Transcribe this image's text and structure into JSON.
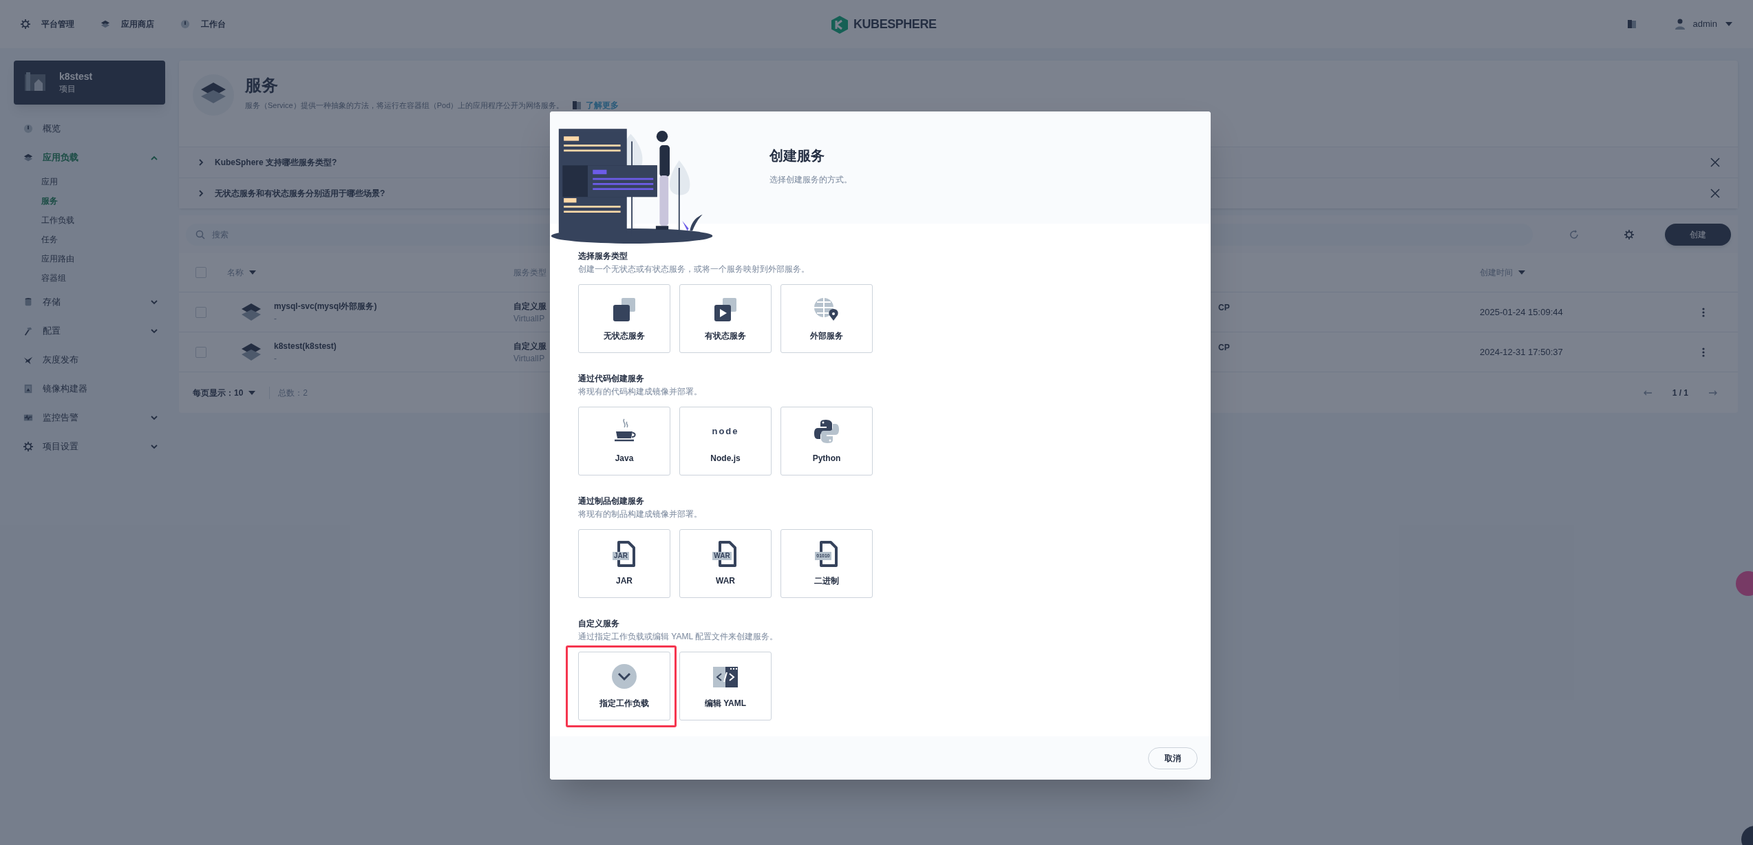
{
  "top_nav": {
    "items": [
      {
        "label": "平台管理"
      },
      {
        "label": "应用商店"
      },
      {
        "label": "工作台"
      }
    ],
    "logo": "KUBESPHERE",
    "user": "admin"
  },
  "sidebar": {
    "project": {
      "name": "k8stest",
      "type": "项目"
    },
    "items": [
      {
        "kind": "link",
        "label": "概览",
        "selected": false
      },
      {
        "kind": "group",
        "label": "应用负载",
        "selected": true,
        "expanded": true,
        "children": [
          {
            "label": "应用",
            "selected": false
          },
          {
            "label": "服务",
            "selected": true
          },
          {
            "label": "工作负载",
            "selected": false
          },
          {
            "label": "任务",
            "selected": false
          },
          {
            "label": "应用路由",
            "selected": false
          },
          {
            "label": "容器组",
            "selected": false
          }
        ]
      },
      {
        "kind": "group",
        "label": "存储",
        "selected": false,
        "expanded": false
      },
      {
        "kind": "group",
        "label": "配置",
        "selected": false,
        "expanded": false
      },
      {
        "kind": "link",
        "label": "灰度发布",
        "selected": false
      },
      {
        "kind": "link",
        "label": "镜像构建器",
        "selected": false
      },
      {
        "kind": "group",
        "label": "监控告警",
        "selected": false,
        "expanded": false
      },
      {
        "kind": "group",
        "label": "项目设置",
        "selected": false,
        "expanded": false
      }
    ]
  },
  "page_header": {
    "title": "服务",
    "description": "服务（Service）提供一种抽象的方法，将运行在容器组（Pod）上的应用程序公开为网络服务。",
    "link": "了解更多"
  },
  "tips": [
    {
      "label": "KubeSphere 支持哪些服务类型?"
    },
    {
      "label": "无状态服务和有状态服务分别适用于哪些场景?"
    }
  ],
  "toolbar": {
    "search": {
      "placeholder": "搜索"
    },
    "create_button": "创建"
  },
  "table": {
    "columns": [
      "名称",
      "服务类型",
      "创建时间"
    ],
    "select_all_checked": false,
    "rows": [
      {
        "checked": false,
        "name": "mysql-svc(mysql外部服务)",
        "description": "-",
        "type": "自定义服",
        "type_detail": "VirtualIP",
        "column_3": "CP",
        "created": "2025-01-24 15:09:44"
      },
      {
        "checked": false,
        "name": "k8stest(k8stest)",
        "description": "-",
        "type": "自定义服",
        "type_detail": "VirtualIP",
        "column_3": "CP",
        "created": "2024-12-31 17:50:37"
      }
    ]
  },
  "footer": {
    "page_size_label": "每页显示：10",
    "total": "总数：2",
    "pages": "1 / 1"
  },
  "modal": {
    "title": "创建服务",
    "subtitle": "选择创建服务的方式。",
    "cancel": "取消",
    "sections": [
      {
        "title": "选择服务类型",
        "description": "创建一个无状态或有状态服务，或将一个服务映射到外部服务。",
        "options": [
          {
            "kind": "stateless",
            "label": "无状态服务",
            "highlighted": false
          },
          {
            "kind": "stateful",
            "label": "有状态服务",
            "highlighted": false
          },
          {
            "kind": "external",
            "label": "外部服务",
            "highlighted": false
          }
        ]
      },
      {
        "title": "通过代码创建服务",
        "description": "将现有的代码构建成镜像并部署。",
        "options": [
          {
            "kind": "java",
            "label": "Java",
            "highlighted": false
          },
          {
            "kind": "nodejs",
            "label": "Node.js",
            "icon_text": "node",
            "highlighted": false
          },
          {
            "kind": "python",
            "label": "Python",
            "highlighted": false
          }
        ]
      },
      {
        "title": "通过制品创建服务",
        "description": "将现有的制品构建成镜像并部署。",
        "options": [
          {
            "kind": "file",
            "label": "JAR",
            "icon_text": "JAR",
            "highlighted": false
          },
          {
            "kind": "file",
            "label": "WAR",
            "icon_text": "WAR",
            "highlighted": false
          },
          {
            "kind": "file",
            "label": "二进制",
            "icon_text": "01010",
            "highlighted": false
          }
        ]
      },
      {
        "title": "自定义服务",
        "description": "通过指定工作负载或编辑 YAML 配置文件来创建服务。",
        "options": [
          {
            "kind": "workload",
            "label": "指定工作负载",
            "highlighted": true
          },
          {
            "kind": "yaml",
            "label": "编辑 YAML",
            "highlighted": false
          }
        ]
      }
    ]
  }
}
